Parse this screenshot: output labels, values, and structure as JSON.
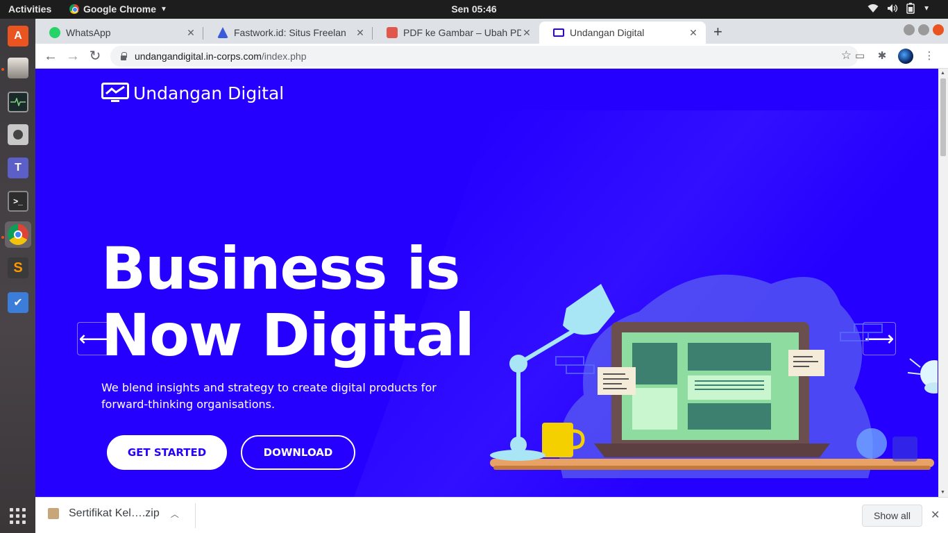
{
  "system": {
    "activities_label": "Activities",
    "app_name": "Google Chrome",
    "clock": "Sen 05:46"
  },
  "browser": {
    "tabs": [
      {
        "title": "WhatsApp",
        "favicon_color": "#25d366"
      },
      {
        "title": "Fastwork.id: Situs Freelan",
        "favicon_color": "#3a5bd9"
      },
      {
        "title": "PDF ke Gambar – Ubah PD",
        "favicon_color": "#e2574c"
      },
      {
        "title": "Undangan Digital",
        "favicon_color": "#2500ff"
      }
    ],
    "active_tab": 3,
    "url_host": "undangandigital.in-corps.com",
    "url_path": "/index.php"
  },
  "page": {
    "brand": "Undangan Digital",
    "hero_line1": "Business is",
    "hero_line2": "Now Digital",
    "subtitle": "We blend insights and strategy to create digital products for forward-thinking organisations.",
    "primary_cta": "GET STARTED",
    "secondary_cta": "DOWNLOAD",
    "prev_arrow": "⟵",
    "next_arrow": "⟶",
    "background_color": "#2500ff"
  },
  "downloads": {
    "file_name": "Sertifikat Kel….zip",
    "show_all_label": "Show all"
  }
}
